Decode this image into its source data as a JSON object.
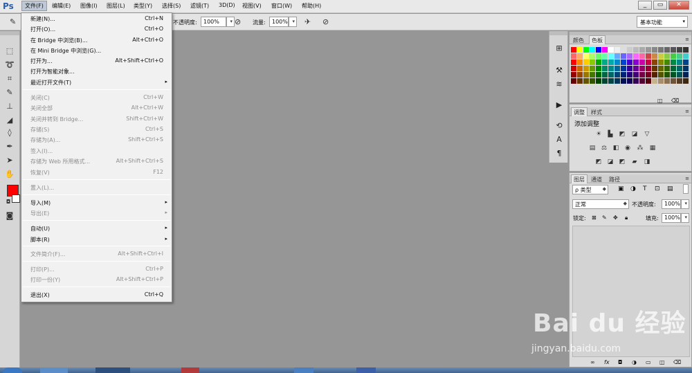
{
  "app": {
    "logo": "Ps"
  },
  "menubar": {
    "items": [
      "文件(F)",
      "编辑(E)",
      "图像(I)",
      "图层(L)",
      "类型(Y)",
      "选择(S)",
      "滤镜(T)",
      "3D(D)",
      "视图(V)",
      "窗口(W)",
      "帮助(H)"
    ],
    "window_buttons": [
      "_",
      "▭",
      "✕"
    ]
  },
  "options": {
    "opacity_label": "不透明度:",
    "opacity_value": "100%",
    "flow_label": "流量:",
    "flow_value": "100%",
    "workspace": "基本功能"
  },
  "file_menu": {
    "items": [
      {
        "label": "新建(N)...",
        "shortcut": "Ctrl+N"
      },
      {
        "label": "打开(O)...",
        "shortcut": "Ctrl+O"
      },
      {
        "label": "在 Bridge 中浏览(B)...",
        "shortcut": "Alt+Ctrl+O"
      },
      {
        "label": "在 Mini Bridge 中浏览(G)...",
        "shortcut": ""
      },
      {
        "label": "打开为...",
        "shortcut": "Alt+Shift+Ctrl+O"
      },
      {
        "label": "打开为智能对象...",
        "shortcut": ""
      },
      {
        "label": "最近打开文件(T)",
        "shortcut": ""
      },
      {
        "label": "关闭(C)",
        "shortcut": "Ctrl+W"
      },
      {
        "label": "关闭全部",
        "shortcut": "Alt+Ctrl+W"
      },
      {
        "label": "关闭并转到 Bridge...",
        "shortcut": "Shift+Ctrl+W"
      },
      {
        "label": "存储(S)",
        "shortcut": "Ctrl+S"
      },
      {
        "label": "存储为(A)...",
        "shortcut": "Shift+Ctrl+S"
      },
      {
        "label": "签入(I)...",
        "shortcut": ""
      },
      {
        "label": "存储为 Web 所用格式...",
        "shortcut": "Alt+Shift+Ctrl+S"
      },
      {
        "label": "恢复(V)",
        "shortcut": "F12"
      },
      {
        "label": "置入(L)...",
        "shortcut": ""
      },
      {
        "label": "导入(M)",
        "shortcut": ""
      },
      {
        "label": "导出(E)",
        "shortcut": ""
      },
      {
        "label": "自动(U)",
        "shortcut": ""
      },
      {
        "label": "脚本(R)",
        "shortcut": ""
      },
      {
        "label": "文件简介(F)...",
        "shortcut": "Alt+Shift+Ctrl+I"
      },
      {
        "label": "打印(P)...",
        "shortcut": "Ctrl+P"
      },
      {
        "label": "打印一份(Y)",
        "shortcut": "Alt+Shift+Ctrl+P"
      },
      {
        "label": "退出(X)",
        "shortcut": "Ctrl+Q"
      }
    ],
    "submenu_arrow": "▸"
  },
  "swatches_panel": {
    "tabs": [
      "颜色",
      "色板"
    ]
  },
  "adjustments_panel": {
    "tabs": [
      "调整",
      "样式"
    ],
    "title": "添加调整"
  },
  "layers_panel": {
    "tabs": [
      "图层",
      "通道",
      "路径"
    ],
    "filter_kind": "ρ 类型",
    "blend_mode": "正常",
    "opacity_label": "不透明度:",
    "opacity_value": "100%",
    "lock_label": "锁定:",
    "fill_label": "填充:",
    "fill_value": "100%",
    "footer_icons": [
      "link-icon",
      "fx-icon",
      "mask-icon",
      "adjustment-icon",
      "group-icon",
      "new-layer-icon",
      "trash-icon"
    ]
  },
  "watermark": {
    "brand": "Bai du 经验",
    "url": "jingyan.baidu.com"
  },
  "colors": {
    "foreground": "#ff0000",
    "background": "#ffffff",
    "canvas": "#969696"
  }
}
